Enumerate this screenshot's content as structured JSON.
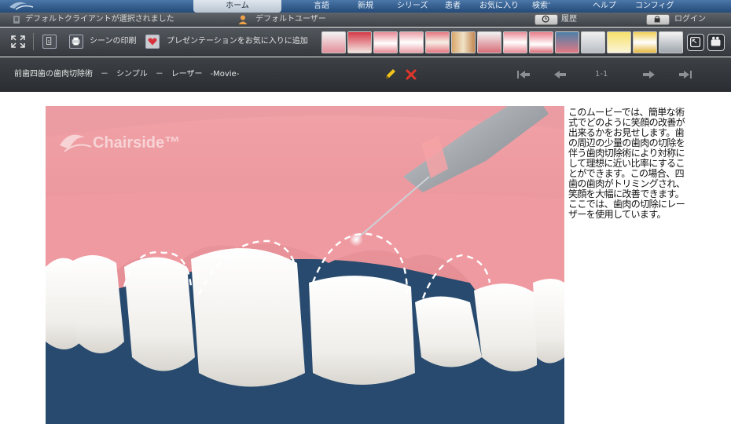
{
  "topnav": {
    "items": [
      "ホーム",
      "言語",
      "新規",
      "シリーズ",
      "患者",
      "お気に入り",
      "検索",
      "ヘルプ",
      "コンフィグ"
    ]
  },
  "status": {
    "client_text": "デフォルトクライアントが選択されました",
    "user_text": "デフォルトユーザー",
    "history_label": "履歴",
    "login_label": "ログイン"
  },
  "toolbar": {
    "print_label": "シーンの印刷",
    "favorite_label": "プレゼンテーションをお気に入りに追加"
  },
  "playbar": {
    "title": "前歯四歯の歯肉切除術　－　シンプル　－　レーザー　-Movie-",
    "counter": "1-1"
  },
  "movie": {
    "watermark": "Chairside™"
  },
  "description": "このムービーでは、簡単な術式でどのように笑顔の改善が出来るかをお見せします。歯の周辺の少量の歯肉の切除を伴う歯肉切除術により対称にして理想に近い比率にすることができます。この場合、四歯の歯肉がトリミングされ、笑顔を大幅に改善できます。ここでは、歯肉の切除にレーザーを使用しています。",
  "colors": {
    "nav_blue": "#2f5d90",
    "toolbar_gray": "#43474c",
    "movie_bg": "#274a6e",
    "gum_pink": "#e58f96",
    "delete_red": "#e2362a",
    "edit_yellow": "#f0c419"
  }
}
